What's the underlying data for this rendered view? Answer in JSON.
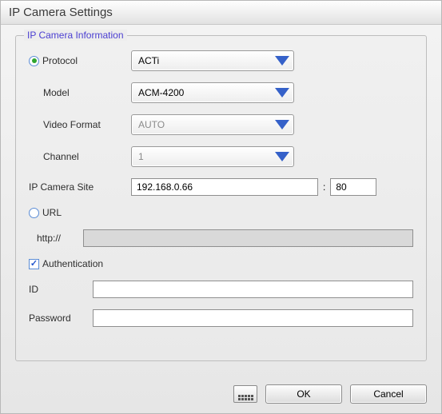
{
  "window": {
    "title": "IP Camera Settings"
  },
  "group": {
    "legend": "IP Camera Information"
  },
  "radio": {
    "protocol_selected": true,
    "url_selected": false,
    "protocol_label": "Protocol",
    "url_label": "URL"
  },
  "labels": {
    "model": "Model",
    "video_format": "Video Format",
    "channel": "Channel",
    "ip_site": "IP Camera Site",
    "auth": "Authentication",
    "id": "ID",
    "password": "Password",
    "http_prefix": "http://",
    "port_sep": ":"
  },
  "combos": {
    "protocol": "ACTi",
    "model": "ACM-4200",
    "video_format": "AUTO",
    "channel": "1"
  },
  "inputs": {
    "ip": "192.168.0.66",
    "port": "80",
    "url": "",
    "id": "",
    "password": ""
  },
  "auth_checked": true,
  "buttons": {
    "ok": "OK",
    "cancel": "Cancel"
  }
}
